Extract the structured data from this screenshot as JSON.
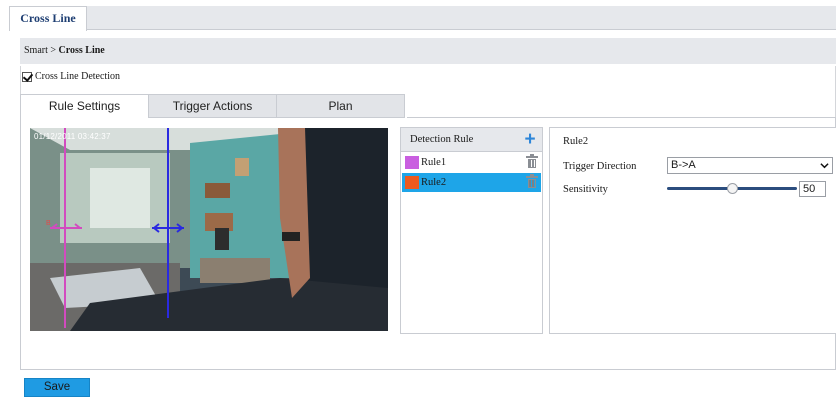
{
  "top_tab": {
    "label": "Cross Line"
  },
  "breadcrumb": {
    "root": "Smart",
    "separator": ">",
    "current": "Cross Line"
  },
  "detection": {
    "label": "Cross Line Detection",
    "checked": true
  },
  "tabs": [
    {
      "label": "Rule Settings",
      "active": true
    },
    {
      "label": "Trigger Actions",
      "active": false
    },
    {
      "label": "Plan",
      "active": false
    }
  ],
  "camera": {
    "timestamp": "01/12/2011 03:42:37"
  },
  "rule_panel": {
    "header": "Detection Rule",
    "add_icon": "plus-icon",
    "rules": [
      {
        "name": "Rule1",
        "color": "#c95ee0",
        "selected": false
      },
      {
        "name": "Rule2",
        "color": "#ee5a1e",
        "selected": true
      }
    ]
  },
  "config": {
    "title": "Rule2",
    "trigger_direction_label": "Trigger Direction",
    "trigger_direction_value": "B->A",
    "sensitivity_label": "Sensitivity",
    "sensitivity_value": "50"
  },
  "colors": {
    "accent": "#1f9be3",
    "selection": "#1ea5e8",
    "brand_text": "#1f3f73"
  },
  "save": {
    "label": "Save"
  }
}
